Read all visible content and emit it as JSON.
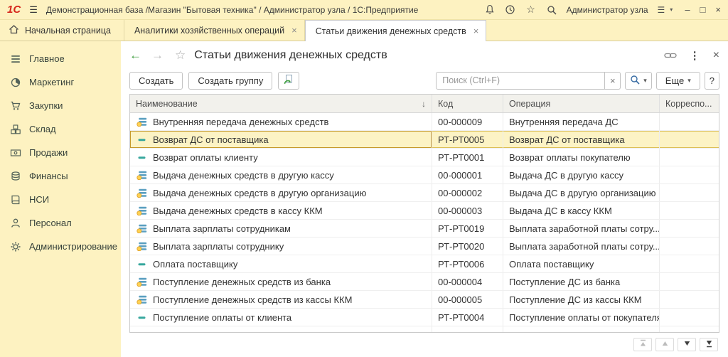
{
  "colors": {
    "accent_yellow": "#fdf2c1",
    "selection_fill": "#fcf3c5",
    "selection_border": "#c5992b",
    "logo_red": "#d6261c",
    "nav_green": "#3f9e3f"
  },
  "window": {
    "logo": "1С",
    "title": "Демонстрационная база /Магазин \"Бытовая техника\" / Администратор узла / 1С:Предприятие",
    "user": "Администратор узла",
    "minimize": "–",
    "maximize": "□",
    "close": "×"
  },
  "tabs": {
    "home_label": "Начальная страница",
    "items": [
      {
        "label": "Аналитики хозяйственных операций",
        "active": false
      },
      {
        "label": "Статьи движения денежных средств",
        "active": true
      }
    ]
  },
  "sidebar": {
    "items": [
      {
        "icon": "main",
        "label": "Главное"
      },
      {
        "icon": "marketing",
        "label": "Маркетинг"
      },
      {
        "icon": "purchases",
        "label": "Закупки"
      },
      {
        "icon": "warehouse",
        "label": "Склад"
      },
      {
        "icon": "sales",
        "label": "Продажи"
      },
      {
        "icon": "finance",
        "label": "Финансы"
      },
      {
        "icon": "nsi",
        "label": "НСИ"
      },
      {
        "icon": "personnel",
        "label": "Персонал"
      },
      {
        "icon": "admin",
        "label": "Администрирование"
      }
    ]
  },
  "content": {
    "title": "Статьи движения денежных средств",
    "toolbar": {
      "create": "Создать",
      "create_group": "Создать группу",
      "search_placeholder": "Поиск (Ctrl+F)",
      "more": "Еще",
      "help": "?"
    },
    "table": {
      "columns": {
        "name": "Наименование",
        "code": "Код",
        "operation": "Операция",
        "correspondence": "Корреспо...",
        "sort_icon": "↓"
      },
      "rows": [
        {
          "icon": "predefined",
          "name": "Внутренняя передача денежных средств",
          "code": "00-000009",
          "operation": "Внутренняя передача ДС",
          "selected": false
        },
        {
          "icon": "item",
          "name": "Возврат ДС от поставщика",
          "code": "РТ-РТ0005",
          "operation": "Возврат ДС от поставщика",
          "selected": true
        },
        {
          "icon": "item",
          "name": "Возврат оплаты клиенту",
          "code": "РТ-РТ0001",
          "operation": "Возврат оплаты покупателю",
          "selected": false
        },
        {
          "icon": "predefined",
          "name": "Выдача денежных средств в другую кассу",
          "code": "00-000001",
          "operation": "Выдача ДС в другую кассу",
          "selected": false
        },
        {
          "icon": "predefined",
          "name": "Выдача денежных средств в другую организацию",
          "code": "00-000002",
          "operation": "Выдача ДС в другую организацию",
          "selected": false
        },
        {
          "icon": "predefined",
          "name": "Выдача денежных средств в кассу ККМ",
          "code": "00-000003",
          "operation": "Выдача ДС в кассу ККМ",
          "selected": false
        },
        {
          "icon": "predefined",
          "name": "Выплата зарплаты сотрудникам",
          "code": "РТ-РТ0019",
          "operation": "Выплата заработной платы сотру...",
          "selected": false
        },
        {
          "icon": "predefined",
          "name": "Выплата зарплаты сотруднику",
          "code": "РТ-РТ0020",
          "operation": "Выплата заработной платы сотру...",
          "selected": false
        },
        {
          "icon": "item",
          "name": "Оплата поставщику",
          "code": "РТ-РТ0006",
          "operation": "Оплата поставщику",
          "selected": false
        },
        {
          "icon": "predefined",
          "name": "Поступление денежных средств из банка",
          "code": "00-000004",
          "operation": "Поступление ДС из банка",
          "selected": false
        },
        {
          "icon": "predefined",
          "name": "Поступление денежных средств из кассы ККМ",
          "code": "00-000005",
          "operation": "Поступление ДС из кассы ККМ",
          "selected": false
        },
        {
          "icon": "item",
          "name": "Поступление оплаты от клиента",
          "code": "РТ-РТ0004",
          "operation": "Поступление оплаты от покупателя",
          "selected": false
        },
        {
          "icon": "item",
          "name": "",
          "code": "",
          "operation": "",
          "selected": false,
          "partial": true
        }
      ]
    },
    "footer_nav": {
      "buttons": [
        {
          "icon": "go-first",
          "disabled": true
        },
        {
          "icon": "page-up",
          "disabled": true
        },
        {
          "icon": "page-down",
          "disabled": false
        },
        {
          "icon": "go-last",
          "disabled": false
        }
      ]
    }
  }
}
